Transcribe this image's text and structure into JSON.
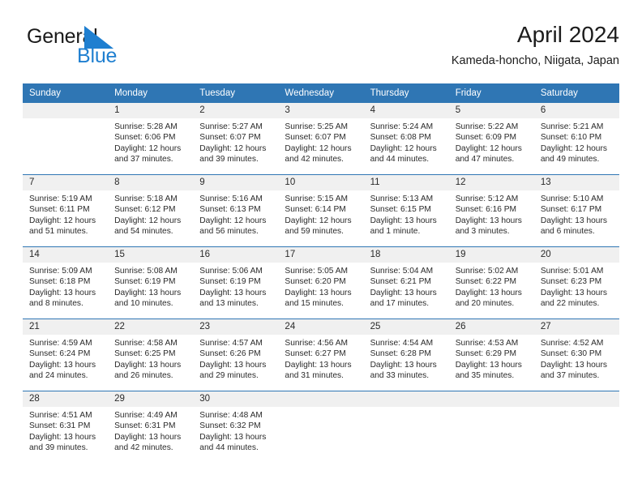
{
  "brand": {
    "name_part1": "General",
    "name_part2": "Blue",
    "mark": "triangle-logo-icon",
    "color_dark": "#1a1a1a",
    "color_blue": "#1f7fd0"
  },
  "header": {
    "title": "April 2024",
    "subtitle": "Kameda-honcho, Niigata, Japan"
  },
  "theme": {
    "header_blue": "#2f76b4",
    "daynum_band": "#f0f0f0",
    "text": "#2a2a2a"
  },
  "weekday_headers": [
    "Sunday",
    "Monday",
    "Tuesday",
    "Wednesday",
    "Thursday",
    "Friday",
    "Saturday"
  ],
  "weeks": [
    [
      {
        "day": "",
        "sunrise": "",
        "sunset": "",
        "daylight_line1": "",
        "daylight_line2": ""
      },
      {
        "day": "1",
        "sunrise": "Sunrise: 5:28 AM",
        "sunset": "Sunset: 6:06 PM",
        "daylight_line1": "Daylight: 12 hours",
        "daylight_line2": "and 37 minutes."
      },
      {
        "day": "2",
        "sunrise": "Sunrise: 5:27 AM",
        "sunset": "Sunset: 6:07 PM",
        "daylight_line1": "Daylight: 12 hours",
        "daylight_line2": "and 39 minutes."
      },
      {
        "day": "3",
        "sunrise": "Sunrise: 5:25 AM",
        "sunset": "Sunset: 6:07 PM",
        "daylight_line1": "Daylight: 12 hours",
        "daylight_line2": "and 42 minutes."
      },
      {
        "day": "4",
        "sunrise": "Sunrise: 5:24 AM",
        "sunset": "Sunset: 6:08 PM",
        "daylight_line1": "Daylight: 12 hours",
        "daylight_line2": "and 44 minutes."
      },
      {
        "day": "5",
        "sunrise": "Sunrise: 5:22 AM",
        "sunset": "Sunset: 6:09 PM",
        "daylight_line1": "Daylight: 12 hours",
        "daylight_line2": "and 47 minutes."
      },
      {
        "day": "6",
        "sunrise": "Sunrise: 5:21 AM",
        "sunset": "Sunset: 6:10 PM",
        "daylight_line1": "Daylight: 12 hours",
        "daylight_line2": "and 49 minutes."
      }
    ],
    [
      {
        "day": "7",
        "sunrise": "Sunrise: 5:19 AM",
        "sunset": "Sunset: 6:11 PM",
        "daylight_line1": "Daylight: 12 hours",
        "daylight_line2": "and 51 minutes."
      },
      {
        "day": "8",
        "sunrise": "Sunrise: 5:18 AM",
        "sunset": "Sunset: 6:12 PM",
        "daylight_line1": "Daylight: 12 hours",
        "daylight_line2": "and 54 minutes."
      },
      {
        "day": "9",
        "sunrise": "Sunrise: 5:16 AM",
        "sunset": "Sunset: 6:13 PM",
        "daylight_line1": "Daylight: 12 hours",
        "daylight_line2": "and 56 minutes."
      },
      {
        "day": "10",
        "sunrise": "Sunrise: 5:15 AM",
        "sunset": "Sunset: 6:14 PM",
        "daylight_line1": "Daylight: 12 hours",
        "daylight_line2": "and 59 minutes."
      },
      {
        "day": "11",
        "sunrise": "Sunrise: 5:13 AM",
        "sunset": "Sunset: 6:15 PM",
        "daylight_line1": "Daylight: 13 hours",
        "daylight_line2": "and 1 minute."
      },
      {
        "day": "12",
        "sunrise": "Sunrise: 5:12 AM",
        "sunset": "Sunset: 6:16 PM",
        "daylight_line1": "Daylight: 13 hours",
        "daylight_line2": "and 3 minutes."
      },
      {
        "day": "13",
        "sunrise": "Sunrise: 5:10 AM",
        "sunset": "Sunset: 6:17 PM",
        "daylight_line1": "Daylight: 13 hours",
        "daylight_line2": "and 6 minutes."
      }
    ],
    [
      {
        "day": "14",
        "sunrise": "Sunrise: 5:09 AM",
        "sunset": "Sunset: 6:18 PM",
        "daylight_line1": "Daylight: 13 hours",
        "daylight_line2": "and 8 minutes."
      },
      {
        "day": "15",
        "sunrise": "Sunrise: 5:08 AM",
        "sunset": "Sunset: 6:19 PM",
        "daylight_line1": "Daylight: 13 hours",
        "daylight_line2": "and 10 minutes."
      },
      {
        "day": "16",
        "sunrise": "Sunrise: 5:06 AM",
        "sunset": "Sunset: 6:19 PM",
        "daylight_line1": "Daylight: 13 hours",
        "daylight_line2": "and 13 minutes."
      },
      {
        "day": "17",
        "sunrise": "Sunrise: 5:05 AM",
        "sunset": "Sunset: 6:20 PM",
        "daylight_line1": "Daylight: 13 hours",
        "daylight_line2": "and 15 minutes."
      },
      {
        "day": "18",
        "sunrise": "Sunrise: 5:04 AM",
        "sunset": "Sunset: 6:21 PM",
        "daylight_line1": "Daylight: 13 hours",
        "daylight_line2": "and 17 minutes."
      },
      {
        "day": "19",
        "sunrise": "Sunrise: 5:02 AM",
        "sunset": "Sunset: 6:22 PM",
        "daylight_line1": "Daylight: 13 hours",
        "daylight_line2": "and 20 minutes."
      },
      {
        "day": "20",
        "sunrise": "Sunrise: 5:01 AM",
        "sunset": "Sunset: 6:23 PM",
        "daylight_line1": "Daylight: 13 hours",
        "daylight_line2": "and 22 minutes."
      }
    ],
    [
      {
        "day": "21",
        "sunrise": "Sunrise: 4:59 AM",
        "sunset": "Sunset: 6:24 PM",
        "daylight_line1": "Daylight: 13 hours",
        "daylight_line2": "and 24 minutes."
      },
      {
        "day": "22",
        "sunrise": "Sunrise: 4:58 AM",
        "sunset": "Sunset: 6:25 PM",
        "daylight_line1": "Daylight: 13 hours",
        "daylight_line2": "and 26 minutes."
      },
      {
        "day": "23",
        "sunrise": "Sunrise: 4:57 AM",
        "sunset": "Sunset: 6:26 PM",
        "daylight_line1": "Daylight: 13 hours",
        "daylight_line2": "and 29 minutes."
      },
      {
        "day": "24",
        "sunrise": "Sunrise: 4:56 AM",
        "sunset": "Sunset: 6:27 PM",
        "daylight_line1": "Daylight: 13 hours",
        "daylight_line2": "and 31 minutes."
      },
      {
        "day": "25",
        "sunrise": "Sunrise: 4:54 AM",
        "sunset": "Sunset: 6:28 PM",
        "daylight_line1": "Daylight: 13 hours",
        "daylight_line2": "and 33 minutes."
      },
      {
        "day": "26",
        "sunrise": "Sunrise: 4:53 AM",
        "sunset": "Sunset: 6:29 PM",
        "daylight_line1": "Daylight: 13 hours",
        "daylight_line2": "and 35 minutes."
      },
      {
        "day": "27",
        "sunrise": "Sunrise: 4:52 AM",
        "sunset": "Sunset: 6:30 PM",
        "daylight_line1": "Daylight: 13 hours",
        "daylight_line2": "and 37 minutes."
      }
    ],
    [
      {
        "day": "28",
        "sunrise": "Sunrise: 4:51 AM",
        "sunset": "Sunset: 6:31 PM",
        "daylight_line1": "Daylight: 13 hours",
        "daylight_line2": "and 39 minutes."
      },
      {
        "day": "29",
        "sunrise": "Sunrise: 4:49 AM",
        "sunset": "Sunset: 6:31 PM",
        "daylight_line1": "Daylight: 13 hours",
        "daylight_line2": "and 42 minutes."
      },
      {
        "day": "30",
        "sunrise": "Sunrise: 4:48 AM",
        "sunset": "Sunset: 6:32 PM",
        "daylight_line1": "Daylight: 13 hours",
        "daylight_line2": "and 44 minutes."
      },
      {
        "day": "",
        "sunrise": "",
        "sunset": "",
        "daylight_line1": "",
        "daylight_line2": ""
      },
      {
        "day": "",
        "sunrise": "",
        "sunset": "",
        "daylight_line1": "",
        "daylight_line2": ""
      },
      {
        "day": "",
        "sunrise": "",
        "sunset": "",
        "daylight_line1": "",
        "daylight_line2": ""
      },
      {
        "day": "",
        "sunrise": "",
        "sunset": "",
        "daylight_line1": "",
        "daylight_line2": ""
      }
    ]
  ]
}
